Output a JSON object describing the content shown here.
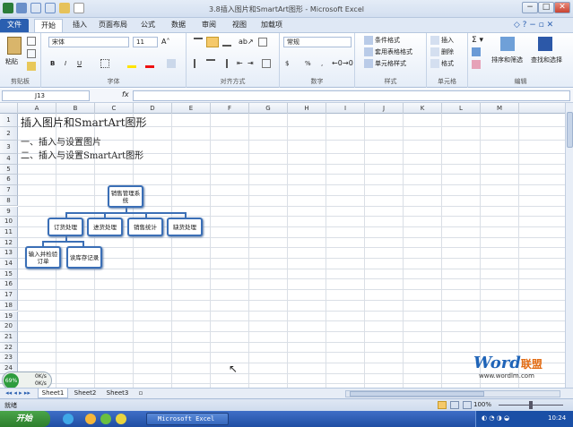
{
  "window": {
    "title": "3.8插入图片和SmartArt图形  -  Microsoft Excel",
    "min": "−",
    "max": "□",
    "close": "✕"
  },
  "tabs": [
    "文件",
    "开始",
    "插入",
    "页面布局",
    "公式",
    "数据",
    "审阅",
    "视图",
    "加载项"
  ],
  "ribbon": {
    "clipboard": {
      "label": "剪贴板",
      "paste": "粘贴"
    },
    "font": {
      "label": "字体",
      "name": "宋体",
      "size": "11",
      "bold": "B",
      "italic": "I",
      "underline": "U"
    },
    "align": {
      "label": "对齐方式"
    },
    "number": {
      "label": "数字",
      "format": "常规",
      "currency": "$",
      "percent": "%"
    },
    "styles": {
      "label": "样式",
      "cond": "条件格式",
      "table": "套用表格格式",
      "cell": "单元格样式"
    },
    "cells": {
      "label": "单元格",
      "insert": "插入",
      "delete": "删除",
      "format": "格式"
    },
    "edit": {
      "label": "编辑",
      "sort": "排序和筛选",
      "find": "查找和选择"
    }
  },
  "formula": {
    "namebox": "J13",
    "fx": "fx",
    "value": ""
  },
  "columns": [
    "A",
    "B",
    "C",
    "D",
    "E",
    "F",
    "G",
    "H",
    "I",
    "J",
    "K",
    "L",
    "M"
  ],
  "rows": [
    "1",
    "2",
    "3",
    "4",
    "5",
    "6",
    "7",
    "8",
    "9",
    "10",
    "11",
    "12",
    "13",
    "14",
    "15",
    "16",
    "17",
    "18",
    "19",
    "20",
    "21",
    "22",
    "23",
    "24",
    "25"
  ],
  "cells": {
    "a1": "插入图片和SmartArt图形",
    "a2": "一、插入与设置图片",
    "a3": "二、插入与设置SmartArt图形"
  },
  "smartart": {
    "root": "销售管理系统",
    "l1": [
      "订货处理",
      "进货处理",
      "销售统计",
      "缺货处理"
    ],
    "l2": [
      "输入并检验订单",
      "读库存记录"
    ]
  },
  "sheets": [
    "Sheet1",
    "Sheet2",
    "Sheet3"
  ],
  "status": {
    "ready": "就绪",
    "zoom": "100%"
  },
  "watermark": {
    "brand1": "Word",
    "brand2": "联盟",
    "url": "www.wordlm.com"
  },
  "overlay": {
    "pct": "69%",
    "up": "0K/s",
    "down": "0K/s"
  },
  "taskbar": {
    "start": "开始",
    "item": "Microsoft Excel ...",
    "time": "10:24"
  }
}
